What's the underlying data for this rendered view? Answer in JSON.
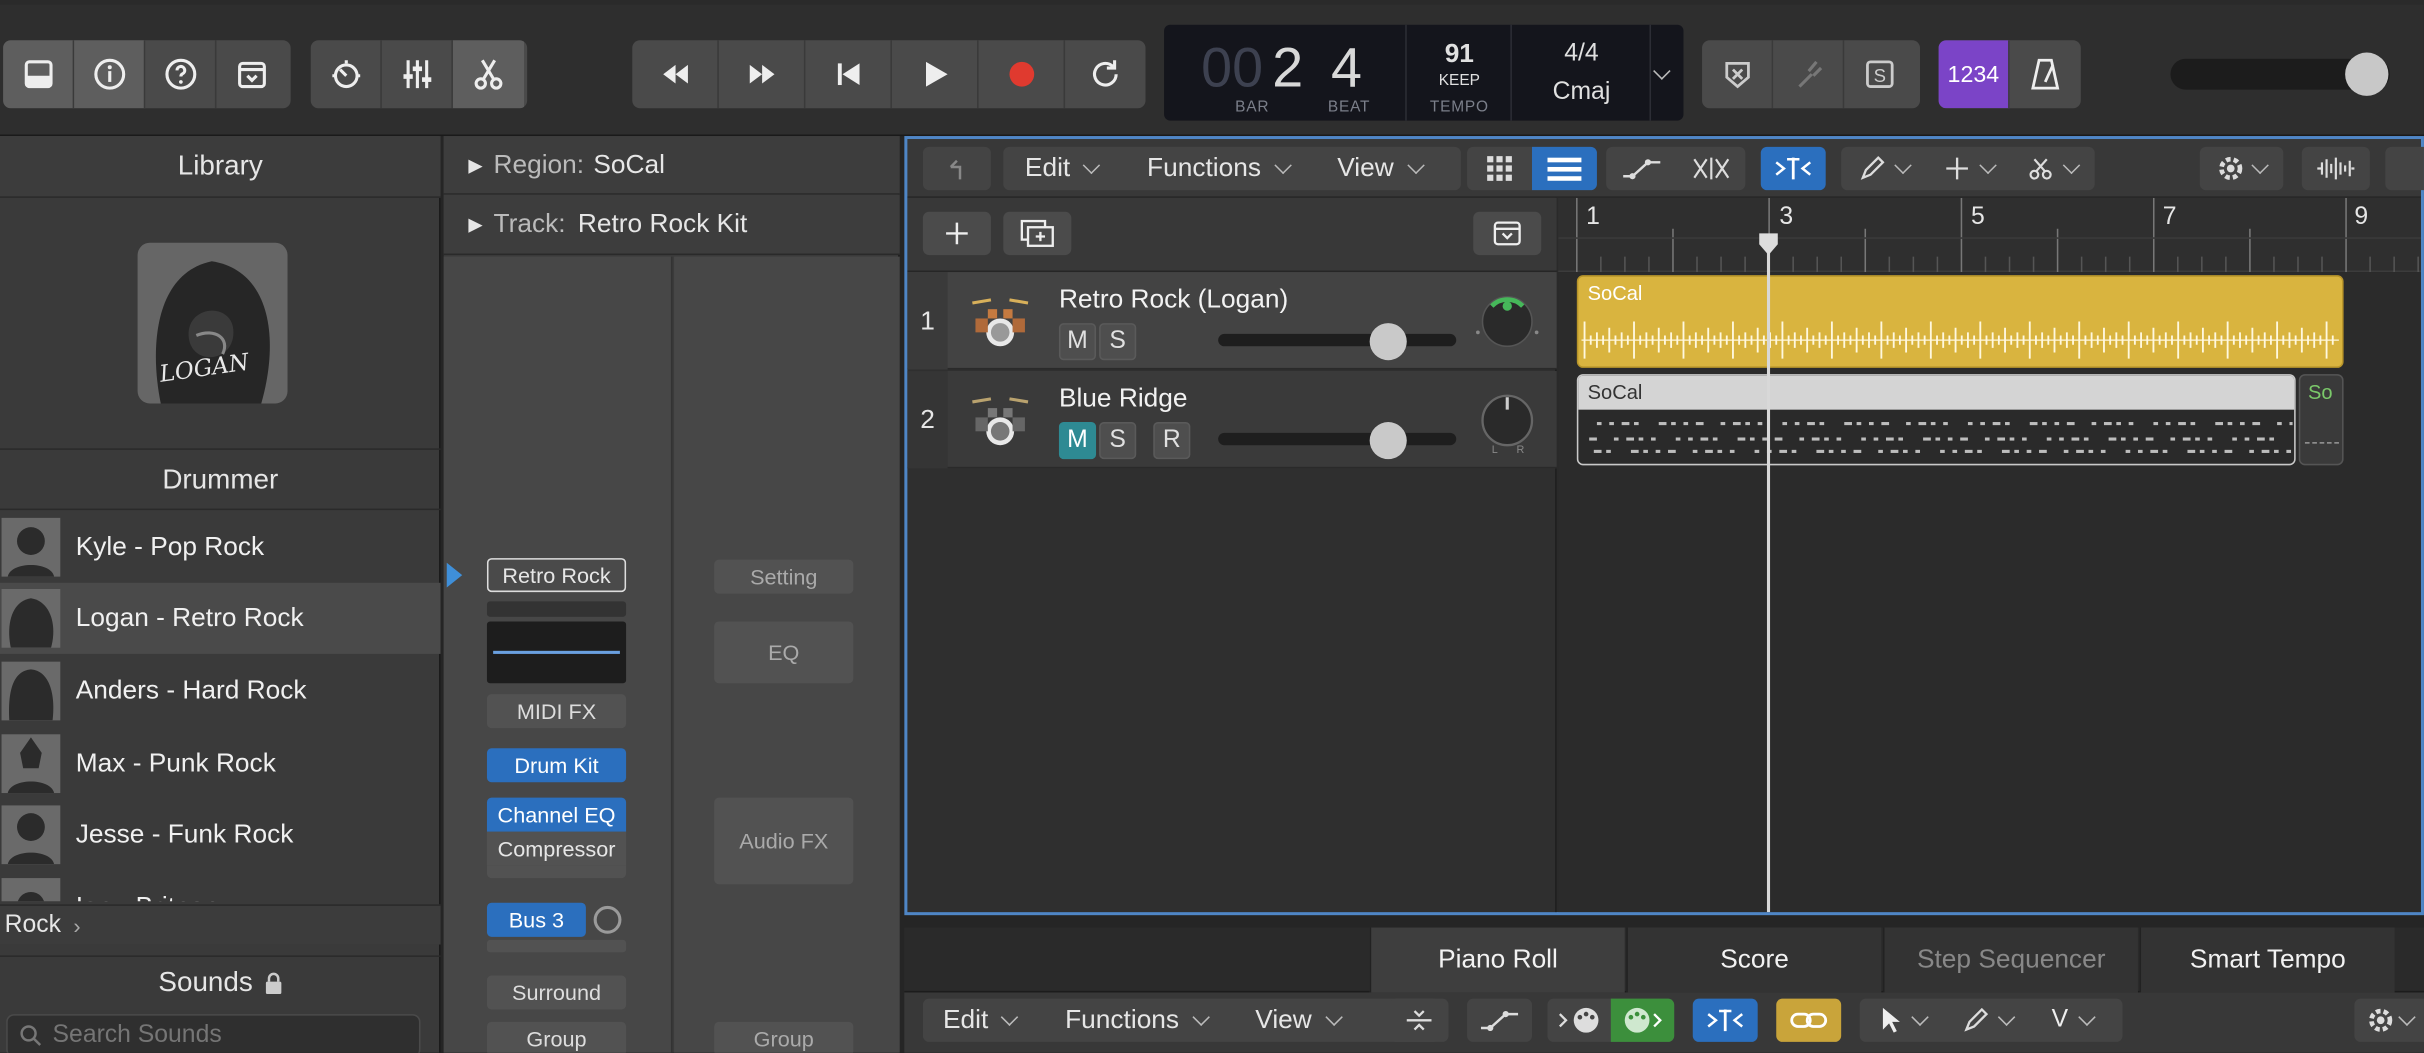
{
  "lcd": {
    "bar_prefix": "00",
    "bar": "2",
    "beat": "4",
    "bar_label": "BAR",
    "beat_label": "BEAT",
    "tempo": "91",
    "tempo_mode": "KEEP",
    "tempo_label": "TEMPO",
    "signature": "4/4",
    "key": "Cmaj"
  },
  "count_in": "1234",
  "library": {
    "title": "Library",
    "artist_sig": "LOGAN",
    "category": "Drummer",
    "drummers": [
      {
        "label": "Kyle - Pop Rock"
      },
      {
        "label": "Logan - Retro Rock"
      },
      {
        "label": "Anders - Hard Rock"
      },
      {
        "label": "Max - Punk Rock"
      },
      {
        "label": "Jesse - Funk Rock"
      },
      {
        "label": "Ian - Britpop"
      }
    ],
    "breadcrumb": "Rock",
    "sounds_label": "Sounds",
    "search_placeholder": "Search Sounds"
  },
  "inspector": {
    "region_label": "Region:",
    "region_name": "SoCal",
    "track_label": "Track:",
    "track_name": "Retro Rock Kit",
    "left": {
      "setting": "Retro Rock",
      "midi_fx": "MIDI FX",
      "instrument": "Drum Kit",
      "fx1": "Channel EQ",
      "fx2": "Compressor",
      "send": "Bus 3",
      "output": "Surround",
      "group": "Group"
    },
    "right": {
      "setting": "Setting",
      "eq": "EQ",
      "audio_fx": "Audio FX",
      "group": "Group"
    }
  },
  "tracks_menu": {
    "edit": "Edit",
    "functions": "Functions",
    "view": "View"
  },
  "ruler": [
    "1",
    "3",
    "5",
    "7",
    "9"
  ],
  "tracks": [
    {
      "num": "1",
      "name": "Retro Rock (Logan)",
      "mute": "M",
      "solo": "S",
      "region": "SoCal",
      "color": "#e3b93c"
    },
    {
      "num": "2",
      "name": "Blue Ridge",
      "mute": "M",
      "solo": "S",
      "rec": "R",
      "region": "SoCal",
      "region2": "So"
    }
  ],
  "bottom": {
    "tabs": [
      "Piano Roll",
      "Score",
      "Step Sequencer",
      "Smart Tempo"
    ],
    "edit": "Edit",
    "functions": "Functions",
    "view": "View",
    "vlabel": "V"
  }
}
